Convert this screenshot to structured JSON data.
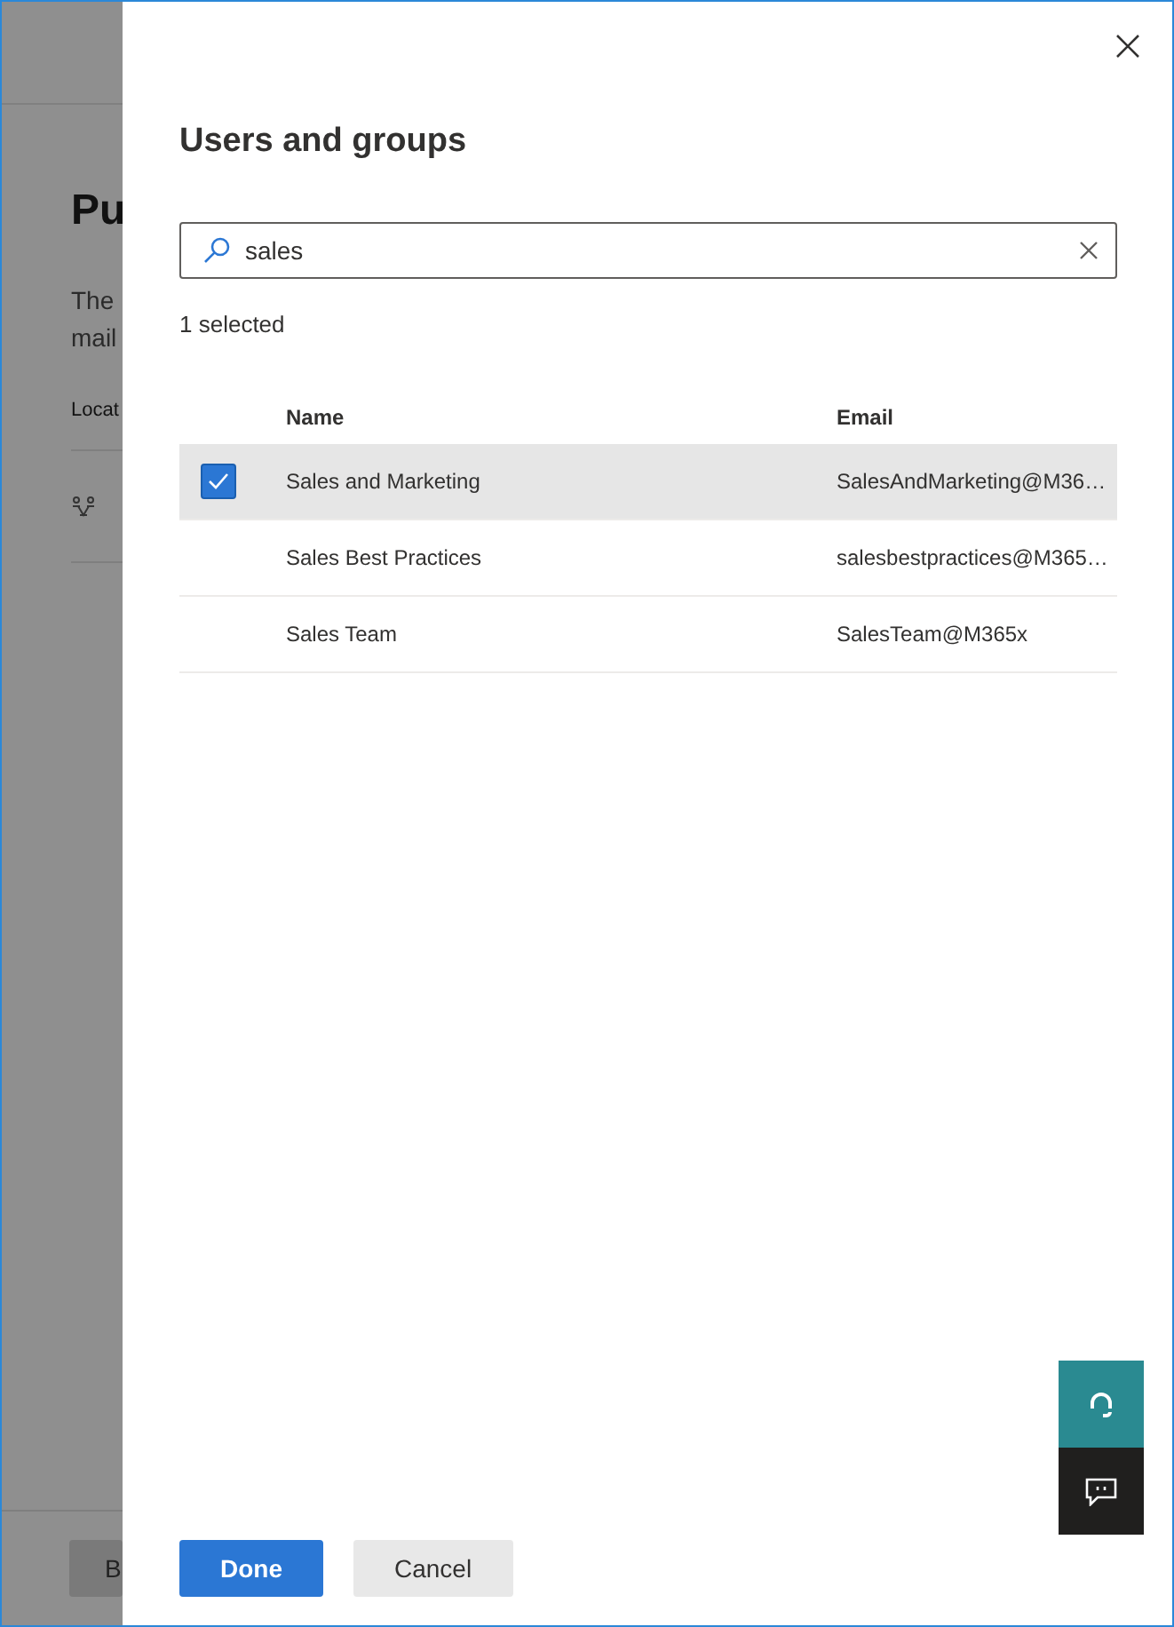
{
  "background_page": {
    "heading": "Pu",
    "description_lines": [
      "The",
      "mail"
    ],
    "column_header": "Locat",
    "back_button": "B"
  },
  "panel": {
    "title": "Users and groups",
    "search": {
      "value": "sales"
    },
    "selection_count": "1 selected",
    "table": {
      "columns": [
        "Name",
        "Email"
      ],
      "rows": [
        {
          "name": "Sales and Marketing",
          "email": "SalesAndMarketing@M36…",
          "selected": true
        },
        {
          "name": "Sales Best Practices",
          "email": "salesbestpractices@M365…",
          "selected": false
        },
        {
          "name": "Sales Team",
          "email": "SalesTeam@M365x",
          "selected": false
        }
      ]
    },
    "buttons": [
      {
        "label": "Done",
        "kind": "primary"
      },
      {
        "label": "Cancel",
        "kind": "secondary"
      }
    ]
  }
}
